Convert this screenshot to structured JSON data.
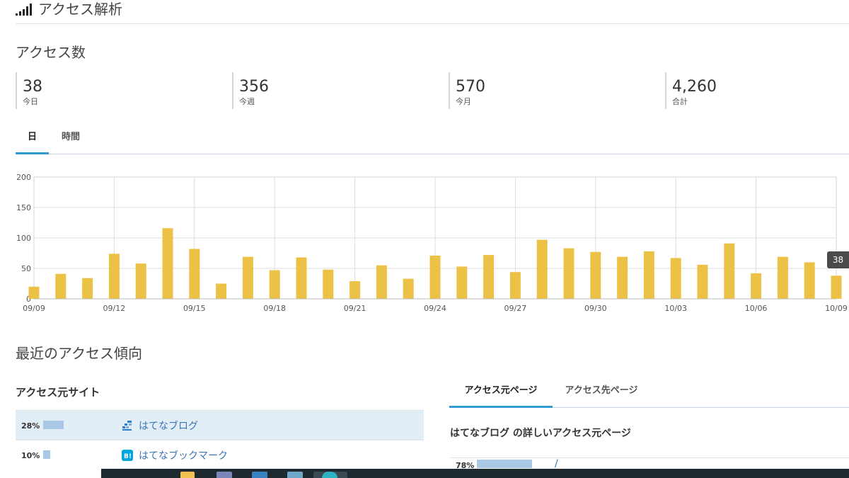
{
  "header": {
    "title": "アクセス解析",
    "icon": "signal-bars-icon"
  },
  "access_count": {
    "title": "アクセス数",
    "stats": [
      {
        "value": "38",
        "label": "今日"
      },
      {
        "value": "356",
        "label": "今週"
      },
      {
        "value": "570",
        "label": "今月"
      },
      {
        "value": "4,260",
        "label": "合計"
      }
    ]
  },
  "period_tabs": [
    {
      "label": "日",
      "active": true
    },
    {
      "label": "時間",
      "active": false
    }
  ],
  "chart_data": {
    "type": "bar",
    "x": [
      "09/09",
      "09/10",
      "09/11",
      "09/12",
      "09/13",
      "09/14",
      "09/15",
      "09/16",
      "09/17",
      "09/18",
      "09/19",
      "09/20",
      "09/21",
      "09/22",
      "09/23",
      "09/24",
      "09/25",
      "09/26",
      "09/27",
      "09/28",
      "09/29",
      "09/30",
      "10/01",
      "10/02",
      "10/03",
      "10/04",
      "10/05",
      "10/06",
      "10/07",
      "10/08",
      "10/09"
    ],
    "values": [
      20,
      41,
      34,
      74,
      58,
      116,
      82,
      25,
      69,
      47,
      68,
      48,
      29,
      55,
      33,
      71,
      53,
      72,
      44,
      97,
      83,
      77,
      69,
      78,
      67,
      56,
      91,
      42,
      69,
      60,
      38
    ],
    "x_tick_labels": [
      "09/09",
      "09/12",
      "09/15",
      "09/18",
      "09/21",
      "09/24",
      "09/27",
      "09/30",
      "10/03",
      "10/06",
      "10/09"
    ],
    "y_ticks": [
      0,
      50,
      100,
      150,
      200
    ],
    "ylim": [
      0,
      200
    ],
    "bar_color": "#ecc246",
    "grid": true,
    "tooltip": "38"
  },
  "trends": {
    "title": "最近のアクセス傾向",
    "referrer_sites": {
      "title": "アクセス元サイト",
      "rows": [
        {
          "percent": "28%",
          "share": 0.28,
          "icon": "hatena-blog-icon",
          "name": "はてなブログ"
        },
        {
          "percent": "10%",
          "share": 0.1,
          "icon": "hatena-bookmark-icon",
          "name": "はてなブックマーク"
        }
      ]
    },
    "page_tabs": [
      {
        "label": "アクセス元ページ",
        "active": true
      },
      {
        "label": "アクセス先ページ",
        "active": false
      }
    ],
    "detail": {
      "title": "はてなブログ の詳しいアクセス元ページ",
      "rows": [
        {
          "percent": "78%",
          "share": 0.78,
          "link": "/"
        }
      ]
    }
  },
  "colors": {
    "accent": "#2e9bd4",
    "bar": "#ecc246",
    "share_bar": "#a8c8e6",
    "link": "#3a74b6"
  }
}
